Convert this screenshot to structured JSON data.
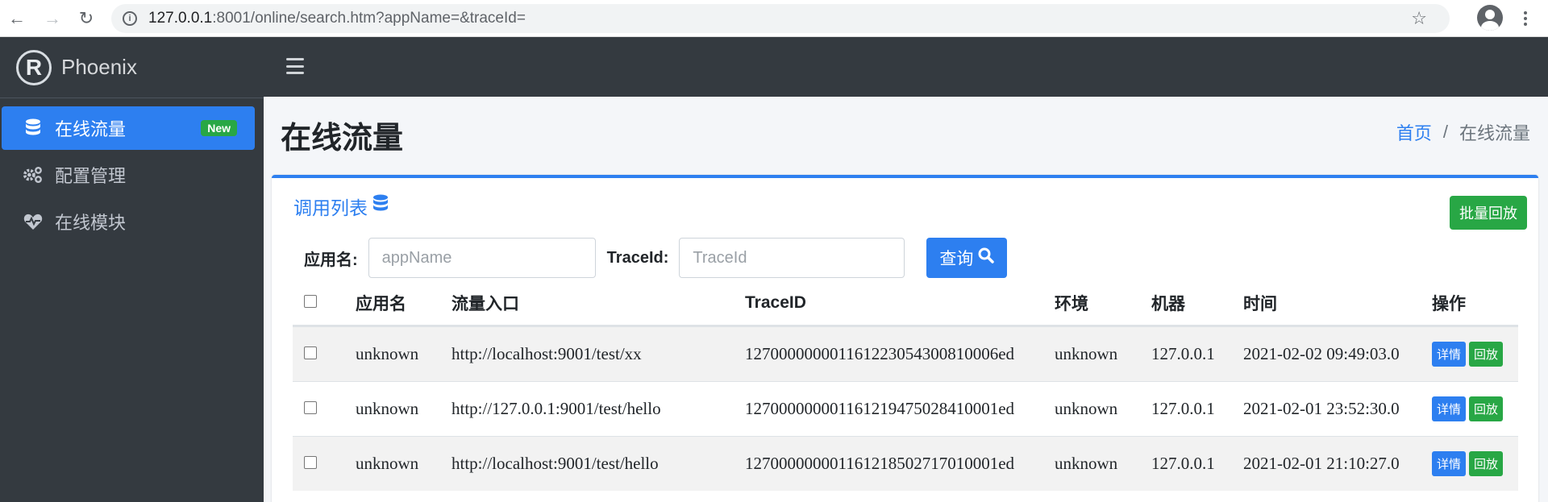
{
  "browser": {
    "url_host": "127.0.0.1",
    "url_rest": ":8001/online/search.htm?appName=&traceId="
  },
  "brand": {
    "logo_letter": "R",
    "name": "Phoenix"
  },
  "sidebar": {
    "items": [
      {
        "label": "在线流量",
        "badge": "New",
        "icon": "database-icon",
        "active": true
      },
      {
        "label": "配置管理",
        "icon": "gears-icon"
      },
      {
        "label": "在线模块",
        "icon": "heartbeat-icon"
      }
    ]
  },
  "header": {
    "title": "在线流量",
    "breadcrumb": {
      "home": "首页",
      "separator": "/",
      "current": "在线流量"
    }
  },
  "card": {
    "title": "调用列表",
    "batch_replay": "批量回放",
    "filters": {
      "app_label": "应用名:",
      "app_placeholder": "appName",
      "trace_label": "TraceId:",
      "trace_placeholder": "TraceId",
      "query_label": "查询"
    },
    "table": {
      "headers": [
        "应用名",
        "流量入口",
        "TraceID",
        "环境",
        "机器",
        "时间",
        "操作"
      ],
      "rows": [
        {
          "app": "unknown",
          "entry": "http://localhost:9001/test/xx",
          "trace": "1270000000011612230543008100 06ed",
          "env": "unknown",
          "host": "127.0.0.1",
          "time": "2021-02-02 09:49:03.0"
        },
        {
          "app": "unknown",
          "entry": "http://127.0.0.1:9001/test/hello",
          "trace": "127000000001161219475028410001ed",
          "env": "unknown",
          "host": "127.0.0.1",
          "time": "2021-02-01 23:52:30.0"
        },
        {
          "app": "unknown",
          "entry": "http://localhost:9001/test/hello",
          "trace": "127000000001161218502717010001ed",
          "env": "unknown",
          "host": "127.0.0.1",
          "time": "2021-02-01 21:10:27.0"
        }
      ],
      "detail_label": "详情",
      "replay_label": "回放"
    }
  },
  "colors": {
    "primary": "#2d7ff0",
    "success": "#28a745",
    "sidebar": "#343a40"
  }
}
